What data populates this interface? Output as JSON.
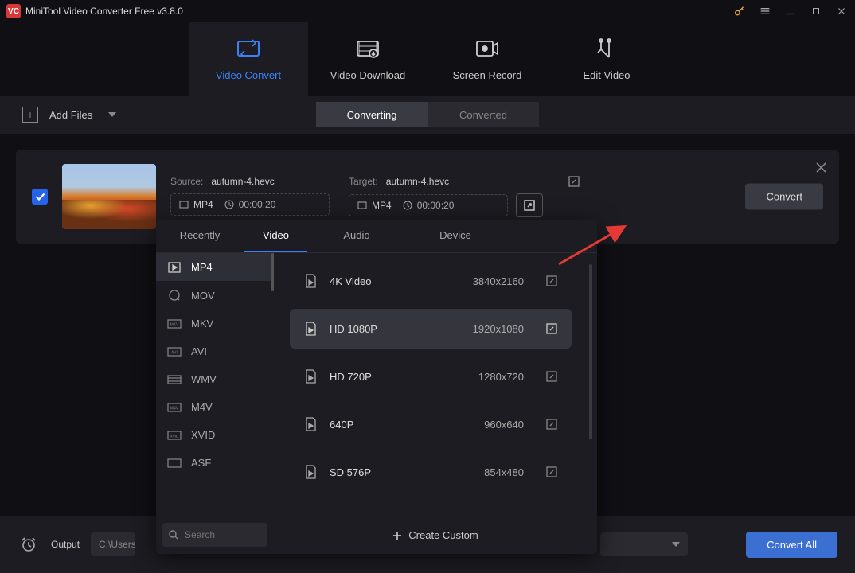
{
  "app": {
    "title": "MiniTool Video Converter Free v3.8.0",
    "logo_text": "VC"
  },
  "nav": [
    {
      "label": "Video Convert",
      "active": true
    },
    {
      "label": "Video Download",
      "active": false
    },
    {
      "label": "Screen Record",
      "active": false
    },
    {
      "label": "Edit Video",
      "active": false
    }
  ],
  "toolbar": {
    "add_files": "Add Files",
    "converting": "Converting",
    "converted": "Converted"
  },
  "file": {
    "source_label": "Source:",
    "source_name": "autumn-4.hevc",
    "source_format": "MP4",
    "source_duration": "00:00:20",
    "target_label": "Target:",
    "target_name": "autumn-4.hevc",
    "target_format": "MP4",
    "target_duration": "00:00:20",
    "convert_btn": "Convert"
  },
  "popup": {
    "tabs": [
      "Recently",
      "Video",
      "Audio",
      "Device"
    ],
    "active_tab": 1,
    "formats": [
      "MP4",
      "MOV",
      "MKV",
      "AVI",
      "WMV",
      "M4V",
      "XVID",
      "ASF"
    ],
    "active_format": 0,
    "resolutions": [
      {
        "name": "4K Video",
        "dims": "3840x2160"
      },
      {
        "name": "HD 1080P",
        "dims": "1920x1080"
      },
      {
        "name": "HD 720P",
        "dims": "1280x720"
      },
      {
        "name": "640P",
        "dims": "960x640"
      },
      {
        "name": "SD 576P",
        "dims": "854x480"
      }
    ],
    "active_res": 1,
    "search_placeholder": "Search",
    "create_custom": "Create Custom"
  },
  "bottom": {
    "output_label": "Output",
    "output_path": "C:\\Users",
    "convert_all": "Convert All"
  }
}
